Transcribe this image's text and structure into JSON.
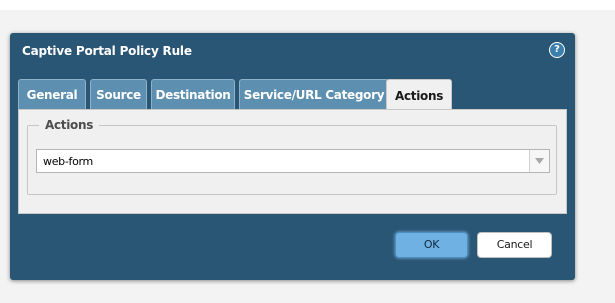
{
  "dialog": {
    "title": "Captive Portal Policy Rule",
    "help_label": "?"
  },
  "tabs": [
    {
      "label": "General",
      "active": false
    },
    {
      "label": "Source",
      "active": false
    },
    {
      "label": "Destination",
      "active": false
    },
    {
      "label": "Service/URL Category",
      "active": false
    },
    {
      "label": "Actions",
      "active": true
    }
  ],
  "actions_section": {
    "legend": "Actions",
    "select_value": "web-form"
  },
  "buttons": {
    "ok_label": "OK",
    "cancel_label": "Cancel"
  },
  "colors": {
    "dialog_bg": "#2a5675",
    "tab_inactive": "#5d8fb0",
    "ok_button": "#6fb1e3"
  },
  "icons": {
    "help": "help-icon",
    "dropdown": "chevron-down-icon"
  }
}
